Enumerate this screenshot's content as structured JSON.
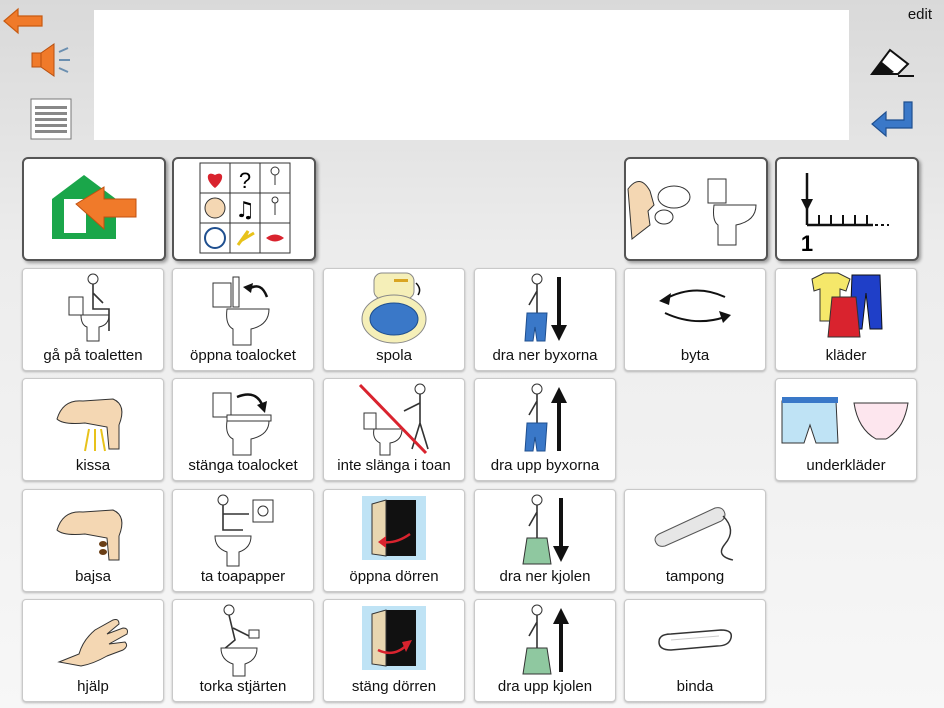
{
  "header": {
    "edit_label": "edit",
    "message_text": "",
    "icons": [
      "back-arrow-icon",
      "speaker-icon",
      "keyboard-icon",
      "eraser-icon",
      "enter-icon"
    ]
  },
  "folders": [
    {
      "name": "home",
      "icon": "home-arrow-icon"
    },
    {
      "name": "symbol-grid",
      "icon": "symbol-grid-icon"
    },
    {
      "name": "talk-toilet",
      "icon": "talk-toilet-icon"
    },
    {
      "name": "number-scale",
      "icon": "number-scale-icon",
      "number": "1"
    }
  ],
  "grid": {
    "row1": [
      {
        "label": "gå på toaletten",
        "icon": "sit-toilet-icon"
      },
      {
        "label": "öppna toalocket",
        "icon": "open-lid-icon"
      },
      {
        "label": "spola",
        "icon": "flush-icon"
      },
      {
        "label": "dra ner byxorna",
        "icon": "pants-down-icon"
      },
      {
        "label": "byta",
        "icon": "swap-arrows-icon"
      },
      {
        "label": "kläder",
        "icon": "clothes-icon"
      }
    ],
    "row2": [
      {
        "label": "kissa",
        "icon": "pee-icon"
      },
      {
        "label": "stänga toalocket",
        "icon": "close-lid-icon"
      },
      {
        "label": "inte slänga i toan",
        "icon": "no-throw-icon"
      },
      {
        "label": "dra upp byxorna",
        "icon": "pants-up-icon"
      },
      {
        "label": "underkläder",
        "icon": "underwear-icon"
      }
    ],
    "row3": [
      {
        "label": "bajsa",
        "icon": "poo-icon"
      },
      {
        "label": "ta toapapper",
        "icon": "toilet-paper-icon"
      },
      {
        "label": "öppna dörren",
        "icon": "open-door-icon"
      },
      {
        "label": "dra ner kjolen",
        "icon": "skirt-down-icon"
      },
      {
        "label": "tampong",
        "icon": "tampon-icon"
      }
    ],
    "row4": [
      {
        "label": "hjälp",
        "icon": "hand-icon"
      },
      {
        "label": "torka stjärten",
        "icon": "wipe-icon"
      },
      {
        "label": "stäng dörren",
        "icon": "close-door-icon"
      },
      {
        "label": "dra upp kjolen",
        "icon": "skirt-up-icon"
      },
      {
        "label": "binda",
        "icon": "pad-icon"
      }
    ]
  },
  "colors": {
    "accent_orange": "#f07a2a",
    "enter_blue": "#3a78c8",
    "home_green": "#1aa64a"
  }
}
